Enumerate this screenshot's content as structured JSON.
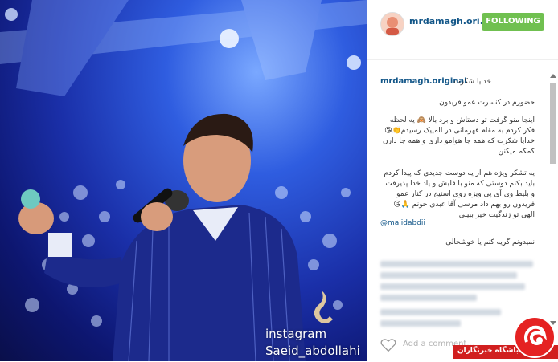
{
  "photo": {
    "watermark_line1": "instagram",
    "watermark_line2": "Saeid_abdollahi"
  },
  "header": {
    "username": "mrdamagh.ori...",
    "follow_label": "FOLLOWING",
    "follow_color": "#70c050",
    "avatar_icon": "profile-avatar"
  },
  "caption": {
    "username": "mrdamagh.original",
    "first_line": "خدایا شکرت",
    "line2": "حضورم در کنسرت عمو فریدون",
    "paragraph1": "اینجا منو گرفت تو دستاش و برد بالا 🙈 یه لحظه فکر کردم به مقام قهرمانی در المپیک رسیدم👏😘 خدایا شکرت که همه جا هوامو داری و همه جا دارن کمکم میکنن",
    "paragraph2": "یه تشکر ویژه هم از یه دوست جدیدی که پیدا کردم باید بکنم دوستی که منو با قلبش و یاد خدا پذیرفت و بلیط وی آی پی ویژه روی استیج در کنار عمو فریدون رو بهم داد مرسی آقا عبدی جونم 🙏😘 الهی تو زندگیت خیر ببینی",
    "mention": "@majidabdii",
    "line_last": "نمیدونم گریه کنم یا خوشحالی"
  },
  "footer": {
    "add_comment_placeholder": "Add a comment...",
    "heart_icon": "heart-icon"
  },
  "badge": {
    "text": "باشگاه خبرنگاران",
    "logo_icon": "news-agency-logo"
  }
}
